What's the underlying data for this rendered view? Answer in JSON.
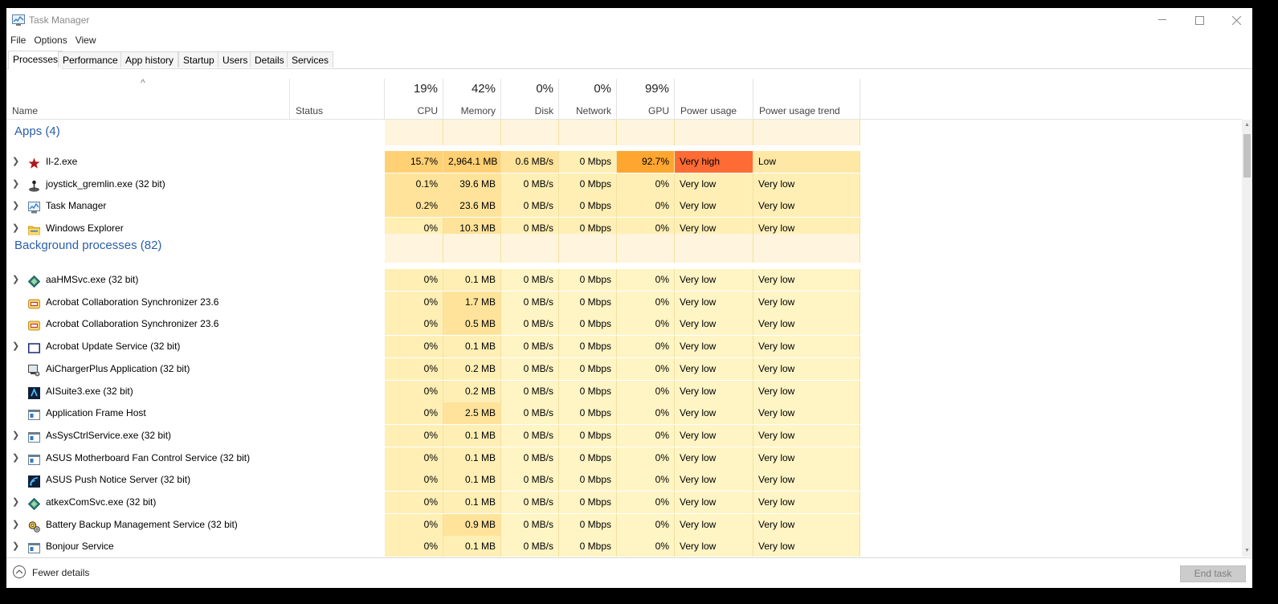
{
  "window": {
    "title": "Task Manager"
  },
  "menu": [
    "File",
    "Options",
    "View"
  ],
  "tabs": [
    "Processes",
    "Performance",
    "App history",
    "Startup",
    "Users",
    "Details",
    "Services"
  ],
  "columns": {
    "name": "Name",
    "status": "Status",
    "cpu": {
      "pct": "19%",
      "label": "CPU"
    },
    "memory": {
      "pct": "42%",
      "label": "Memory"
    },
    "disk": {
      "pct": "0%",
      "label": "Disk"
    },
    "network": {
      "pct": "0%",
      "label": "Network"
    },
    "gpu": {
      "pct": "99%",
      "label": "GPU"
    },
    "power": "Power usage",
    "power_trend": "Power usage trend"
  },
  "groups": {
    "apps": "Apps (4)",
    "background": "Background processes (82)"
  },
  "apps": [
    {
      "name": "Il-2.exe",
      "cpu": "15.7%",
      "memory": "2,964.1 MB",
      "disk": "0.6 MB/s",
      "network": "0 Mbps",
      "gpu": "92.7%",
      "power": "Very high",
      "trend": "Low"
    },
    {
      "name": "joystick_gremlin.exe (32 bit)",
      "cpu": "0.1%",
      "memory": "39.6 MB",
      "disk": "0 MB/s",
      "network": "0 Mbps",
      "gpu": "0%",
      "power": "Very low",
      "trend": "Very low"
    },
    {
      "name": "Task Manager",
      "cpu": "0.2%",
      "memory": "23.6 MB",
      "disk": "0 MB/s",
      "network": "0 Mbps",
      "gpu": "0%",
      "power": "Very low",
      "trend": "Very low"
    },
    {
      "name": "Windows Explorer",
      "cpu": "0%",
      "memory": "10.3 MB",
      "disk": "0 MB/s",
      "network": "0 Mbps",
      "gpu": "0%",
      "power": "Very low",
      "trend": "Very low"
    }
  ],
  "background": [
    {
      "name": "aaHMSvc.exe (32 bit)",
      "cpu": "0%",
      "memory": "0.1 MB",
      "disk": "0 MB/s",
      "network": "0 Mbps",
      "gpu": "0%",
      "power": "Very low",
      "trend": "Very low"
    },
    {
      "name": "Acrobat Collaboration Synchronizer 23.6",
      "cpu": "0%",
      "memory": "1.7 MB",
      "disk": "0 MB/s",
      "network": "0 Mbps",
      "gpu": "0%",
      "power": "Very low",
      "trend": "Very low"
    },
    {
      "name": "Acrobat Collaboration Synchronizer 23.6",
      "cpu": "0%",
      "memory": "0.5 MB",
      "disk": "0 MB/s",
      "network": "0 Mbps",
      "gpu": "0%",
      "power": "Very low",
      "trend": "Very low"
    },
    {
      "name": "Acrobat Update Service (32 bit)",
      "cpu": "0%",
      "memory": "0.1 MB",
      "disk": "0 MB/s",
      "network": "0 Mbps",
      "gpu": "0%",
      "power": "Very low",
      "trend": "Very low"
    },
    {
      "name": "AiChargerPlus Application (32 bit)",
      "cpu": "0%",
      "memory": "0.2 MB",
      "disk": "0 MB/s",
      "network": "0 Mbps",
      "gpu": "0%",
      "power": "Very low",
      "trend": "Very low"
    },
    {
      "name": "AISuite3.exe (32 bit)",
      "cpu": "0%",
      "memory": "0.2 MB",
      "disk": "0 MB/s",
      "network": "0 Mbps",
      "gpu": "0%",
      "power": "Very low",
      "trend": "Very low"
    },
    {
      "name": "Application Frame Host",
      "cpu": "0%",
      "memory": "2.5 MB",
      "disk": "0 MB/s",
      "network": "0 Mbps",
      "gpu": "0%",
      "power": "Very low",
      "trend": "Very low"
    },
    {
      "name": "AsSysCtrlService.exe (32 bit)",
      "cpu": "0%",
      "memory": "0.1 MB",
      "disk": "0 MB/s",
      "network": "0 Mbps",
      "gpu": "0%",
      "power": "Very low",
      "trend": "Very low"
    },
    {
      "name": "ASUS Motherboard Fan Control Service (32 bit)",
      "cpu": "0%",
      "memory": "0.1 MB",
      "disk": "0 MB/s",
      "network": "0 Mbps",
      "gpu": "0%",
      "power": "Very low",
      "trend": "Very low"
    },
    {
      "name": "ASUS Push Notice Server (32 bit)",
      "cpu": "0%",
      "memory": "0.1 MB",
      "disk": "0 MB/s",
      "network": "0 Mbps",
      "gpu": "0%",
      "power": "Very low",
      "trend": "Very low"
    },
    {
      "name": "atkexComSvc.exe (32 bit)",
      "cpu": "0%",
      "memory": "0.1 MB",
      "disk": "0 MB/s",
      "network": "0 Mbps",
      "gpu": "0%",
      "power": "Very low",
      "trend": "Very low"
    },
    {
      "name": "Battery Backup Management Service (32 bit)",
      "cpu": "0%",
      "memory": "0.9 MB",
      "disk": "0 MB/s",
      "network": "0 Mbps",
      "gpu": "0%",
      "power": "Very low",
      "trend": "Very low"
    },
    {
      "name": "Bonjour Service",
      "cpu": "0%",
      "memory": "0.1 MB",
      "disk": "0 MB/s",
      "network": "0 Mbps",
      "gpu": "0%",
      "power": "Very low",
      "trend": "Very low"
    }
  ],
  "footer": {
    "fewer_details": "Fewer details",
    "end_task": "End task"
  },
  "colors": {
    "group_text": "#2b5ea9",
    "gpu_hot": "#ffa630",
    "power_very_high": "#ff6b35",
    "heat_light": "#fff4c4"
  }
}
